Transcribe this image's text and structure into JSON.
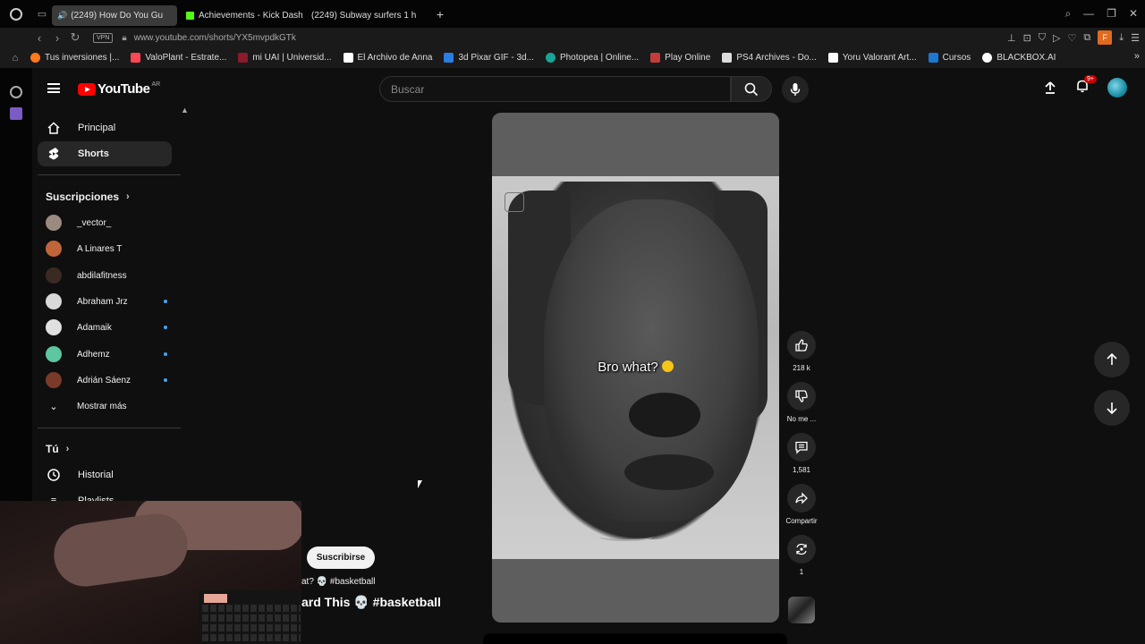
{
  "browser": {
    "tabs": [
      {
        "label": "(2249) How Do You Gu",
        "active": true,
        "icon": "youtube-icon"
      },
      {
        "label": "Achievements - Kick Dash",
        "active": false,
        "icon": "kick-icon"
      },
      {
        "label": "(2249) Subway surfers 1 h",
        "active": false,
        "icon": "youtube-icon"
      }
    ],
    "vpn_label": "VPN",
    "url": "www.youtube.com/shorts/YX5mvpdkGTk",
    "profile_initial": "F",
    "bookmarks": [
      {
        "label": "Tus inversiones |...",
        "color": "#ff7a1a"
      },
      {
        "label": "ValoPlant - Estrate...",
        "color": "#ff4655"
      },
      {
        "label": "mi UAI | Universid...",
        "color": "#8b1a2b"
      },
      {
        "label": "El Archivo de Anna",
        "color": "#ffffff"
      },
      {
        "label": "3d Pixar GIF - 3d...",
        "color": "#2a7de1"
      },
      {
        "label": "Photopea | Online...",
        "color": "#18a497"
      },
      {
        "label": "Play Online",
        "color": "#c43b3b"
      },
      {
        "label": "PS4 Archives - Do...",
        "color": "#dddddd"
      },
      {
        "label": "Yoru Valorant Art...",
        "color": "#ffffff"
      },
      {
        "label": "Cursos",
        "color": "#1b78d0"
      },
      {
        "label": "BLACKBOX.AI",
        "color": "#ffffff"
      }
    ]
  },
  "youtube": {
    "logo_text": "YouTube",
    "country": "AR",
    "search_placeholder": "Buscar",
    "notifications_badge": "9+",
    "guide": {
      "home": "Principal",
      "shorts": "Shorts",
      "subscriptions_header": "Suscripciones",
      "subscriptions": [
        {
          "name": "_vector_",
          "new": false,
          "color": "#9a8a80"
        },
        {
          "name": "A Linares T",
          "new": false,
          "color": "#c0643a"
        },
        {
          "name": "abdilafitness",
          "new": false,
          "color": "#3a2a22"
        },
        {
          "name": "Abraham Jrz",
          "new": true,
          "color": "#d8d8d8"
        },
        {
          "name": "Adamaik",
          "new": true,
          "color": "#e0e0e0"
        },
        {
          "name": "Adhemz",
          "new": true,
          "color": "#5cc7a0"
        },
        {
          "name": "Adrián Sáenz",
          "new": true,
          "color": "#7a3a2a"
        }
      ],
      "show_more": "Mostrar más",
      "you_header": "Tú",
      "history": "Historial",
      "playlists": "Playlists"
    },
    "short": {
      "overlay_text": "Bro what?",
      "likes": "218 k",
      "dislike_label": "No me ...",
      "comments": "1,581",
      "share_label": "Compartir",
      "remix_count": "1",
      "subscribe_label": "Suscribirse",
      "caption_line": "at? 💀 #basketball",
      "title_line": "ard This 💀 #basketball"
    }
  }
}
